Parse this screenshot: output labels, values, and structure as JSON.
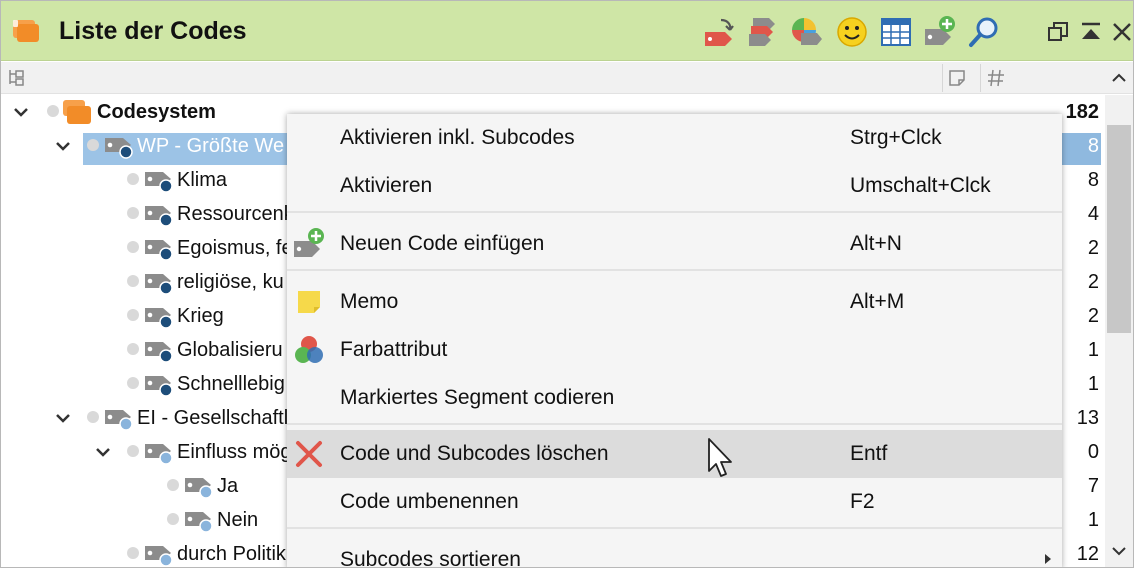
{
  "window": {
    "title": "Liste der Codes"
  },
  "toolbar": {
    "icons": [
      "code-link-icon",
      "code-color-icon",
      "color-wheel-icon",
      "smiley-icon",
      "table-icon",
      "new-code-icon",
      "search-icon"
    ],
    "window_buttons": [
      "undock-icon",
      "collapse-icon",
      "close-icon"
    ]
  },
  "colors": {
    "titlebar": "#cfe6a6",
    "selection": "#9cc3e6",
    "menu_highlight": "#dcdcdc",
    "code_dark": "#1d4d7a",
    "code_light": "#8ab4dc",
    "codesystem_orange": "#f28c28"
  },
  "tree": {
    "root": {
      "label": "Codesystem",
      "count": "182"
    },
    "rows": [
      {
        "label": "WP - Größte We",
        "count": "8"
      },
      {
        "label": "Klima",
        "count": "8"
      },
      {
        "label": "Ressourcenk",
        "count": "4"
      },
      {
        "label": "Egoismus, fe",
        "count": "2"
      },
      {
        "label": "religiöse, ku",
        "count": "2"
      },
      {
        "label": "Krieg",
        "count": "2"
      },
      {
        "label": "Globalisieru",
        "count": "1"
      },
      {
        "label": "Schnelllebig",
        "count": "1"
      },
      {
        "label": "EI - Gesellschaftl",
        "count": "13"
      },
      {
        "label": "Einfluss mög",
        "count": "0"
      },
      {
        "label": "Ja",
        "count": "7"
      },
      {
        "label": "Nein",
        "count": "1"
      },
      {
        "label": "durch Politik",
        "count": "12"
      }
    ]
  },
  "context_menu": {
    "items": [
      {
        "label": "Aktivieren inkl. Subcodes",
        "shortcut": "Strg+Clck"
      },
      {
        "label": "Aktivieren",
        "shortcut": "Umschalt+Clck"
      },
      {
        "label": "Neuen Code einfügen",
        "shortcut": "Alt+N",
        "icon": "new-code-icon"
      },
      {
        "label": "Memo",
        "shortcut": "Alt+M",
        "icon": "memo-icon"
      },
      {
        "label": "Farbattribut",
        "shortcut": "",
        "icon": "color-attribute-icon"
      },
      {
        "label": "Markiertes Segment codieren",
        "shortcut": ""
      },
      {
        "label": "Code und Subcodes löschen",
        "shortcut": "Entf",
        "icon": "delete-icon"
      },
      {
        "label": "Code umbenennen",
        "shortcut": "F2"
      },
      {
        "label": "Subcodes sortieren",
        "shortcut": ""
      }
    ]
  }
}
